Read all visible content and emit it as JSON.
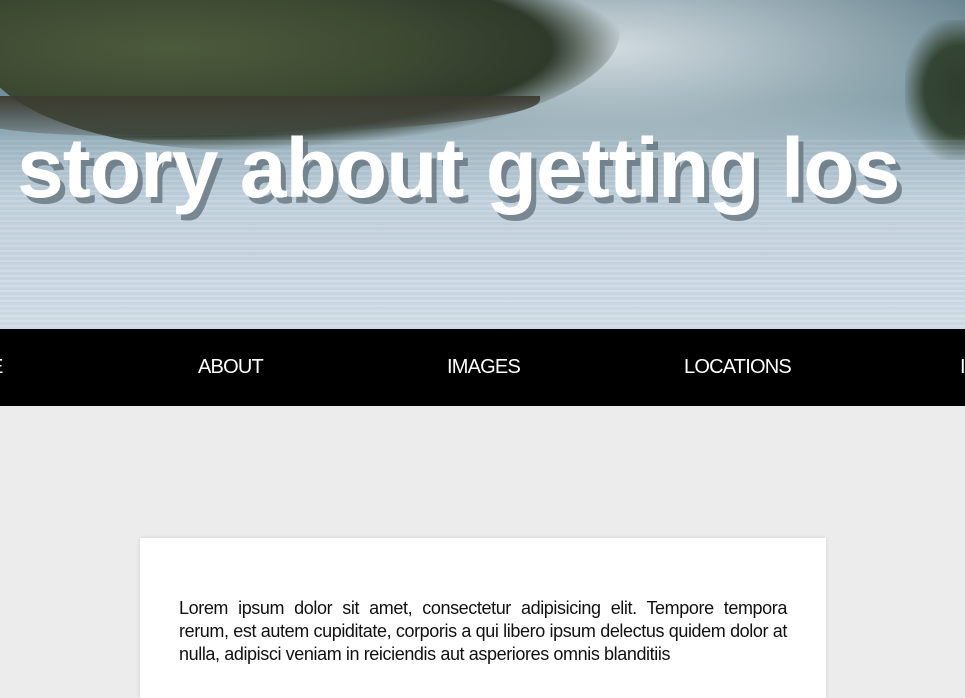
{
  "hero": {
    "title": "story about getting los"
  },
  "nav": {
    "items": [
      {
        "label": "E"
      },
      {
        "label": "ABOUT"
      },
      {
        "label": "IMAGES"
      },
      {
        "label": "LOCATIONS"
      },
      {
        "label": "I"
      }
    ]
  },
  "article": {
    "body": "Lorem ipsum dolor sit amet, consectetur adipisicing elit. Tempore tempora rerum, est autem cupiditate, corporis a qui libero ipsum delectus quidem dolor at nulla, adipisci veniam in reiciendis aut asperiores omnis blanditiis"
  }
}
